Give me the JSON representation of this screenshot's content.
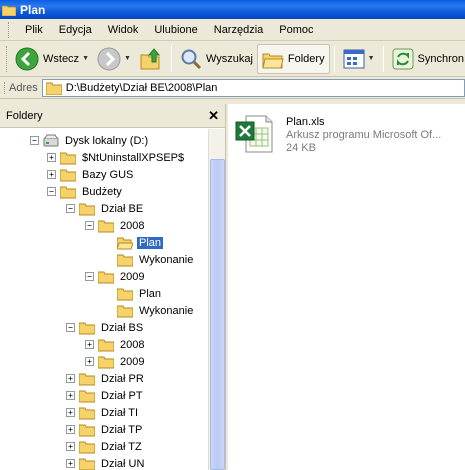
{
  "window": {
    "title": "Plan"
  },
  "menu": [
    "Plik",
    "Edycja",
    "Widok",
    "Ulubione",
    "Narzędzia",
    "Pomoc"
  ],
  "toolbar": {
    "back_label": "Wstecz",
    "search_label": "Wyszukaj",
    "folders_label": "Foldery",
    "sync_label": "Synchron"
  },
  "address": {
    "label": "Adres",
    "value": "D:\\Budżety\\Dział BE\\2008\\Plan"
  },
  "folders_pane": {
    "title": "Foldery",
    "tree": [
      {
        "label": "Dysk lokalny (D:)",
        "expander": "−",
        "icon": "drive-icon"
      },
      {
        "label": "$NtUninstallXPSEP$",
        "expander": "+",
        "icon": "folder-icon"
      },
      {
        "label": "Bazy GUS",
        "expander": "+",
        "icon": "folder-icon"
      },
      {
        "label": "Budżety",
        "expander": "−",
        "icon": "folder-icon"
      },
      {
        "label": "Dział BE",
        "expander": "−",
        "icon": "folder-icon"
      },
      {
        "label": "2008",
        "expander": "−",
        "icon": "folder-icon"
      },
      {
        "label": "Plan",
        "expander": "",
        "icon": "folder-open-icon",
        "selected": true
      },
      {
        "label": "Wykonanie",
        "expander": "",
        "icon": "folder-icon"
      },
      {
        "label": "2009",
        "expander": "−",
        "icon": "folder-icon"
      },
      {
        "label": "Plan",
        "expander": "",
        "icon": "folder-icon"
      },
      {
        "label": "Wykonanie",
        "expander": "",
        "icon": "folder-icon"
      },
      {
        "label": "Dział BS",
        "expander": "−",
        "icon": "folder-icon"
      },
      {
        "label": "2008",
        "expander": "+",
        "icon": "folder-icon"
      },
      {
        "label": "2009",
        "expander": "+",
        "icon": "folder-icon"
      },
      {
        "label": "Dział PR",
        "expander": "+",
        "icon": "folder-icon"
      },
      {
        "label": "Dział PT",
        "expander": "+",
        "icon": "folder-icon"
      },
      {
        "label": "Dział TI",
        "expander": "+",
        "icon": "folder-icon"
      },
      {
        "label": "Dział TP",
        "expander": "+",
        "icon": "folder-icon"
      },
      {
        "label": "Dział TZ",
        "expander": "+",
        "icon": "folder-icon"
      },
      {
        "label": "Dział UN",
        "expander": "+",
        "icon": "folder-icon"
      }
    ]
  },
  "files": [
    {
      "name": "Plan.xls",
      "type": "Arkusz programu Microsoft Of...",
      "size": "24 KB",
      "icon": "excel-file-icon"
    }
  ],
  "colors": {
    "selection": "#316ac5",
    "titlebar": "#0a5ee0"
  }
}
